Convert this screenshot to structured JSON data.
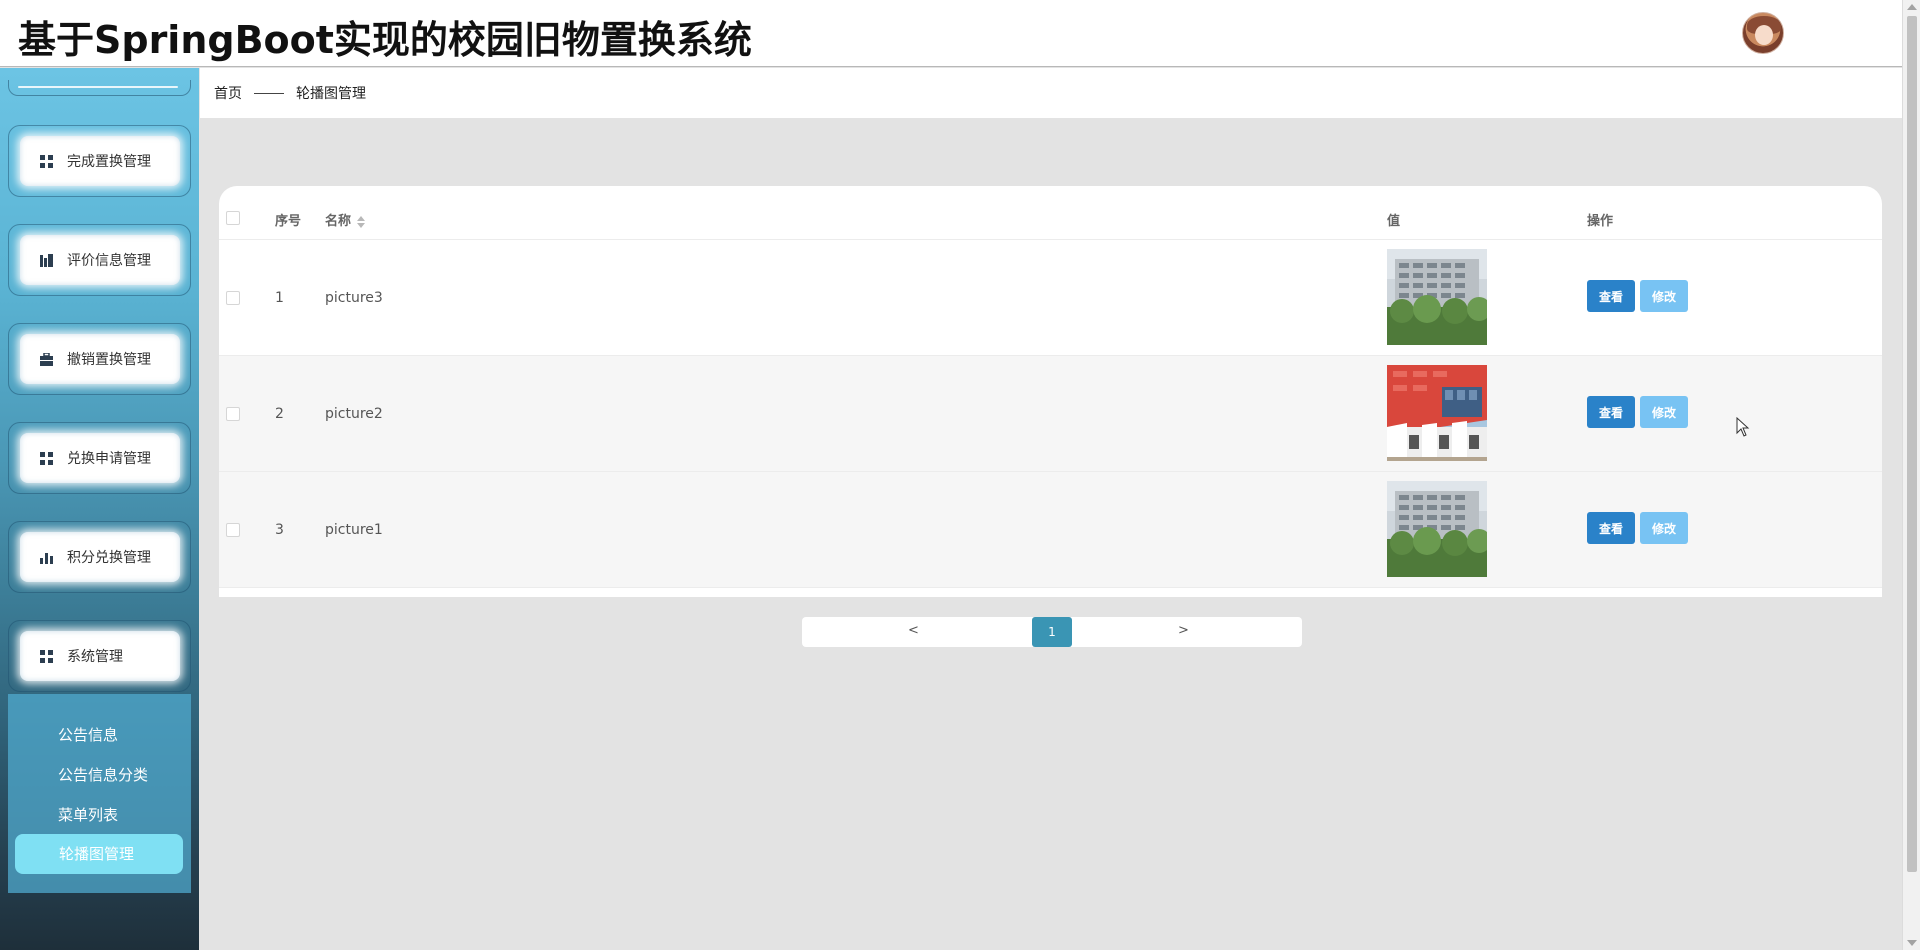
{
  "header": {
    "title": "基于SpringBoot实现的校园旧物置换系统"
  },
  "sidebar": {
    "items": [
      {
        "label": "完成置换管理",
        "icon": "grid-icon"
      },
      {
        "label": "评价信息管理",
        "icon": "chart-building-icon"
      },
      {
        "label": "撤销置换管理",
        "icon": "briefcase-icon"
      },
      {
        "label": "兑换申请管理",
        "icon": "grid-icon"
      },
      {
        "label": "积分兑换管理",
        "icon": "bar-chart-icon"
      },
      {
        "label": "系统管理",
        "icon": "grid-icon"
      }
    ],
    "submenu": [
      {
        "label": "公告信息"
      },
      {
        "label": "公告信息分类"
      },
      {
        "label": "菜单列表"
      },
      {
        "label": "轮播图管理",
        "active": true
      }
    ]
  },
  "breadcrumb": {
    "home": "首页",
    "current": "轮播图管理"
  },
  "table": {
    "columns": {
      "index": "序号",
      "name": "名称",
      "value": "值",
      "actions": "操作"
    },
    "rows": [
      {
        "index": "1",
        "name": "picture3",
        "image": "gray-building"
      },
      {
        "index": "2",
        "name": "picture2",
        "image": "red-building"
      },
      {
        "index": "3",
        "name": "picture1",
        "image": "gray-building"
      }
    ],
    "view_label": "查看",
    "edit_label": "修改"
  },
  "pagination": {
    "prev": "<",
    "current": "1",
    "next": ">"
  },
  "colors": {
    "view_button": "#2a82c9",
    "edit_button": "#78c3f3",
    "active_page": "#3a95b4",
    "active_submenu": "#7fe0f3"
  }
}
